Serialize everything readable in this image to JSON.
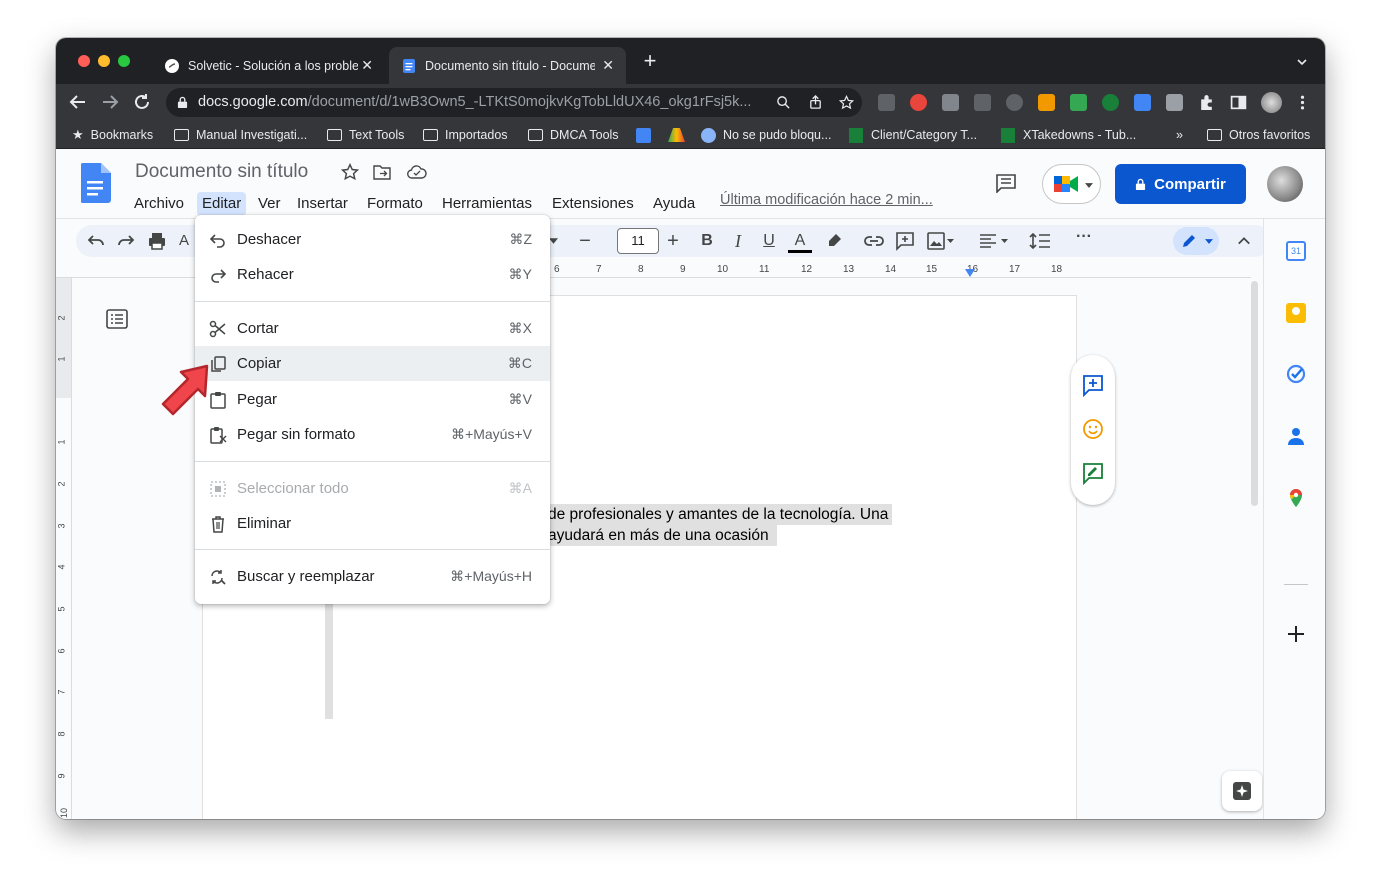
{
  "browser": {
    "tabs": [
      {
        "title": "Solvetic - Solución a los proble",
        "active": false
      },
      {
        "title": "Documento sin título - Docume",
        "active": true
      }
    ],
    "url_host": "docs.google.com",
    "url_path": "/document/d/1wB3Own5_-LTKtS0mojkvKgTobLldUX46_okg1rFsj5k..."
  },
  "bookmarks": {
    "items": [
      "Bookmarks",
      "Manual Investigati...",
      "Text Tools",
      "Importados",
      "DMCA Tools",
      "No se pudo bloqu...",
      "Client/Category T...",
      "XTakedowns - Tub..."
    ],
    "more": "»",
    "other": "Otros favoritos"
  },
  "docs": {
    "title": "Documento sin título",
    "menus": [
      "Archivo",
      "Editar",
      "Ver",
      "Insertar",
      "Formato",
      "Herramientas",
      "Extensiones",
      "Ayuda"
    ],
    "last_modified": "Última modificación hace 2 min...",
    "share_label": "Compartir",
    "font_size": "11"
  },
  "ruler": {
    "h_numbers": [
      "6",
      "7",
      "8",
      "9",
      "10",
      "11",
      "12",
      "13",
      "14",
      "15",
      "16",
      "17",
      "18"
    ],
    "v_numbers": [
      "2",
      "1",
      "1",
      "2",
      "3",
      "4",
      "5",
      "6",
      "7",
      "8",
      "9",
      "10"
    ]
  },
  "content": {
    "line1": "de profesionales y amantes de la tecnología. Una",
    "line2": "ayudará en más de una ocasión"
  },
  "edit_menu": {
    "items": [
      {
        "label": "Deshacer",
        "shortcut": "⌘Z",
        "icon": "undo-icon",
        "disabled": false
      },
      {
        "label": "Rehacer",
        "shortcut": "⌘Y",
        "icon": "redo-icon",
        "disabled": false
      },
      {
        "label": "Cortar",
        "shortcut": "⌘X",
        "icon": "scissors-icon",
        "disabled": false
      },
      {
        "label": "Copiar",
        "shortcut": "⌘C",
        "icon": "copy-icon",
        "disabled": false,
        "highlighted": true
      },
      {
        "label": "Pegar",
        "shortcut": "⌘V",
        "icon": "clipboard-icon",
        "disabled": false
      },
      {
        "label": "Pegar sin formato",
        "shortcut": "⌘+Mayús+V",
        "icon": "clipboard-plain-icon",
        "disabled": false
      },
      {
        "label": "Seleccionar todo",
        "shortcut": "⌘A",
        "icon": "select-all-icon",
        "disabled": true
      },
      {
        "label": "Eliminar",
        "shortcut": "",
        "icon": "trash-icon",
        "disabled": false
      },
      {
        "label": "Buscar y reemplazar",
        "shortcut": "⌘+Mayús+H",
        "icon": "find-replace-icon",
        "disabled": false
      }
    ]
  },
  "side_panel": {
    "calendar_day": "31"
  },
  "colors": {
    "accent": "#0b57d0",
    "menu_highlight": "#d3e3fd",
    "arrow": "#f0454a"
  }
}
